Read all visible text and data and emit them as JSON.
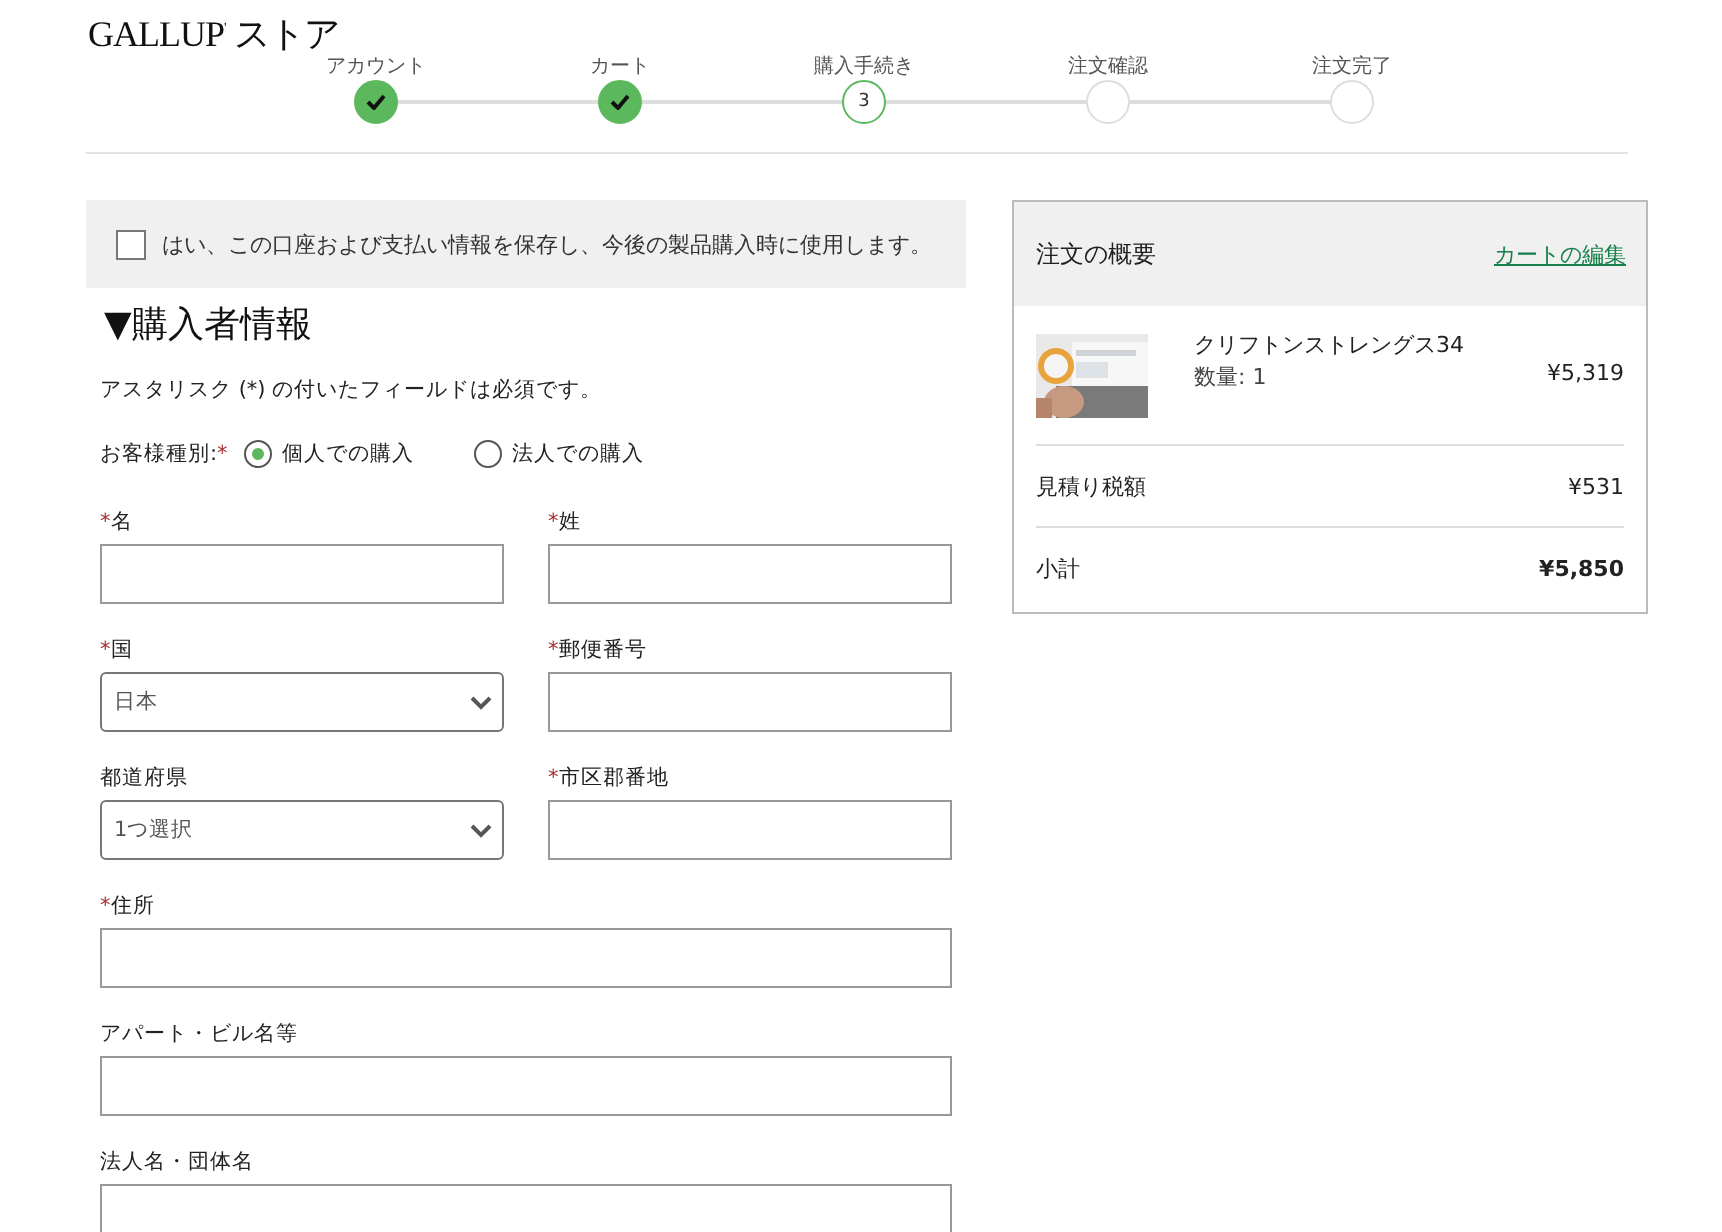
{
  "logo": "GALLUP$^{'}$ ストア",
  "steps": [
    {
      "label": "アカウント",
      "done": true,
      "current": false
    },
    {
      "label": "カート",
      "done": true,
      "current": false
    },
    {
      "label": "購入手続き",
      "done": false,
      "current": true,
      "number": "3"
    },
    {
      "label": "注文確認",
      "done": false,
      "current": false
    },
    {
      "label": "注文完了",
      "done": false,
      "current": false
    }
  ],
  "save_option": {
    "label": "はい、この口座および支払い情報を保存し、今後の製品購入時に使用します。",
    "checked": false
  },
  "section": {
    "marker": "▼",
    "title": "購入者情報",
    "expanded": true
  },
  "note": "アスタリスク (*) の付いたフィールドは必須です。",
  "customer_type": {
    "label": "お客様種別:",
    "mark": "*",
    "options": [
      {
        "label": "個人での購入",
        "selected": true
      },
      {
        "label": "法人での購入",
        "selected": false
      }
    ]
  },
  "fields": [
    {
      "mark": "*",
      "label": "名",
      "kind": "input",
      "full_width": false
    },
    {
      "mark": "*",
      "label": "姓",
      "kind": "input",
      "full_width": false
    },
    {
      "mark": "*",
      "label": "国",
      "kind": "select",
      "value": "日本",
      "full_width": false
    },
    {
      "mark": "*",
      "label": "郵便番号",
      "kind": "input",
      "full_width": false
    },
    {
      "label": "都道府県",
      "kind": "select",
      "value": "1つ選択",
      "full_width": false
    },
    {
      "mark": "*",
      "label": "市区郡番地",
      "kind": "input",
      "full_width": false
    },
    {
      "mark": "*",
      "label": "住所",
      "kind": "input",
      "full_width": true
    },
    {
      "label": "アパート・ビル名等",
      "kind": "input",
      "full_width": true
    },
    {
      "label": "法人名・団体名",
      "kind": "input",
      "full_width": true
    }
  ],
  "summary": {
    "title": "注文の概要",
    "edit_link": "カートの編集",
    "item": {
      "kind": "picture",
      "name": "クリフトンストレングス34",
      "quantity": "数量: 1",
      "price": "¥5,319"
    },
    "rows": [
      {
        "label": "見積り税額",
        "value": "¥531",
        "bold": false
      },
      {
        "label": "小計",
        "value": "¥5,850",
        "bold": true
      }
    ]
  }
}
